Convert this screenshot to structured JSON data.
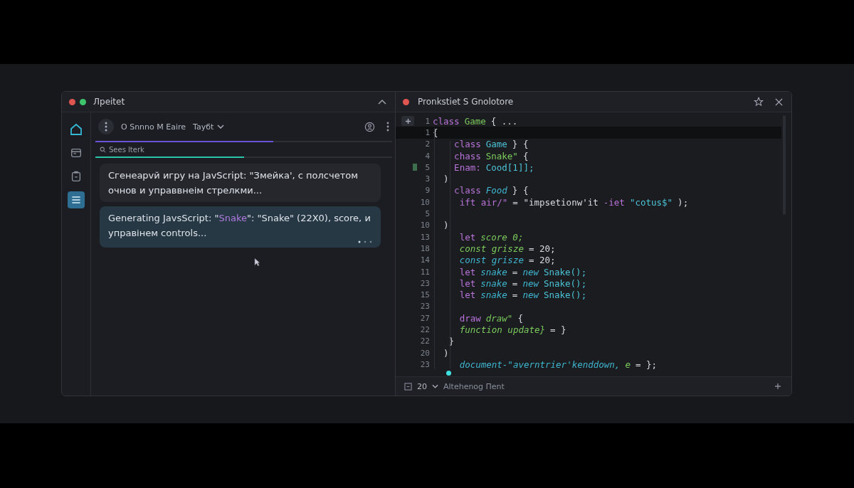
{
  "chat_window": {
    "title": "Лpeitet",
    "sidebar": [
      {
        "selected": true
      },
      {
        "selected": false
      },
      {
        "selected": false
      },
      {
        "selected": true
      }
    ],
    "header": {
      "session": "O Snnno M Eaire",
      "model": "Tayбt"
    },
    "progress": {
      "level": 0.6
    },
    "search": {
      "placeholder": "Sees lterk",
      "level": 0.5
    },
    "messages": [
      {
        "kind": "prompt",
        "segments": [
          {
            "text": "Сгенеарvй игру на JavScript: \"Змейка', с полсчетом очнов и управвнеім стрелкми...",
            "highlight": false
          }
        ],
        "typing": false
      },
      {
        "kind": "reply",
        "segments": [
          {
            "text": "Generating JavsScript: \"",
            "highlight": false
          },
          {
            "text": "Snake",
            "highlight": true
          },
          {
            "text": "\": \"Snake\" (22X0), score, и управінем controls...",
            "highlight": false
          }
        ],
        "typing": true
      }
    ]
  },
  "editor_window": {
    "title": "Pronkstiet S Gnolotore",
    "lines": [
      {
        "number": "1",
        "modified": false,
        "current": false,
        "tokens": [
          {
            "kind": "keyword",
            "text": "class"
          },
          {
            "kind": "name",
            "text": "Game"
          },
          {
            "kind": "plain",
            "text": "{ ..."
          }
        ]
      },
      {
        "number": "1",
        "modified": false,
        "current": true,
        "tokens": [
          {
            "kind": "plain",
            "text": "{"
          }
        ]
      },
      {
        "number": "2",
        "modified": false,
        "current": false,
        "tokens": [
          {
            "kind": "keyword",
            "text": "    class"
          },
          {
            "kind": "type",
            "text": "Game"
          },
          {
            "kind": "plain",
            "text": "} {"
          }
        ]
      },
      {
        "number": "4",
        "modified": false,
        "current": false,
        "tokens": [
          {
            "kind": "keyword",
            "text": "    chass"
          },
          {
            "kind": "name",
            "text": "Snake\""
          },
          {
            "kind": "plain",
            "text": "{"
          }
        ]
      },
      {
        "number": "5",
        "modified": true,
        "current": false,
        "tokens": [
          {
            "kind": "keyword",
            "text": "    Enam:"
          },
          {
            "kind": "type",
            "text": "Cood[1]];"
          }
        ]
      },
      {
        "number": "3",
        "modified": false,
        "current": false,
        "tokens": [
          {
            "kind": "plain",
            "text": "  )"
          }
        ]
      },
      {
        "number": "9",
        "modified": false,
        "current": false,
        "tokens": [
          {
            "kind": "keyword",
            "text": "    class"
          },
          {
            "kind": "ref",
            "text": "Food"
          },
          {
            "kind": "plain",
            "text": "} {"
          }
        ]
      },
      {
        "number": "10",
        "modified": false,
        "current": false,
        "tokens": [
          {
            "kind": "keyword",
            "text": "     ift air/\""
          },
          {
            "kind": "plain",
            "text": "= \"impsetionw'it"
          },
          {
            "kind": "keyword",
            "text": "-iet"
          },
          {
            "kind": "type",
            "text": "\"cotus$\""
          },
          {
            "kind": "plain",
            "text": ");"
          }
        ]
      },
      {
        "number": "5",
        "modified": false,
        "current": false
      },
      {
        "number": "10",
        "modified": false,
        "current": false,
        "tokens": [
          {
            "kind": "plain",
            "text": "  )"
          }
        ]
      },
      {
        "number": "13",
        "modified": false,
        "current": false,
        "tokens": [
          {
            "kind": "keyword",
            "text": "     let"
          },
          {
            "kind": "value",
            "text": "score 0;"
          }
        ]
      },
      {
        "number": "18",
        "modified": false,
        "current": false,
        "tokens": [
          {
            "kind": "value",
            "text": "     const grisze"
          },
          {
            "kind": "plain",
            "text": "= 20;"
          }
        ]
      },
      {
        "number": "14",
        "modified": false,
        "current": false,
        "tokens": [
          {
            "kind": "ref",
            "text": "     const grisze"
          },
          {
            "kind": "plain",
            "text": "= 20;"
          }
        ]
      },
      {
        "number": "11",
        "modified": false,
        "current": false,
        "tokens": [
          {
            "kind": "keyword",
            "text": "     let"
          },
          {
            "kind": "ref",
            "text": "snake"
          },
          {
            "kind": "plain",
            "text": "="
          },
          {
            "kind": "ref",
            "text": "new"
          },
          {
            "kind": "type",
            "text": "Snake();"
          }
        ]
      },
      {
        "number": "23",
        "modified": false,
        "current": false,
        "tokens": [
          {
            "kind": "keyword",
            "text": "     let"
          },
          {
            "kind": "ref",
            "text": "snake"
          },
          {
            "kind": "plain",
            "text": "="
          },
          {
            "kind": "ref",
            "text": "new"
          },
          {
            "kind": "type",
            "text": "Snake();"
          }
        ]
      },
      {
        "number": "15",
        "modified": false,
        "current": false,
        "tokens": [
          {
            "kind": "keyword",
            "text": "     let"
          },
          {
            "kind": "ref",
            "text": "snake"
          },
          {
            "kind": "plain",
            "text": "="
          },
          {
            "kind": "ref",
            "text": "new"
          },
          {
            "kind": "type",
            "text": "Snake();"
          }
        ]
      },
      {
        "number": "23",
        "modified": false,
        "current": false
      },
      {
        "number": "27",
        "modified": false,
        "current": false,
        "tokens": [
          {
            "kind": "keyword",
            "text": "     draw"
          },
          {
            "kind": "value",
            "text": "draw\""
          },
          {
            "kind": "plain",
            "text": "{"
          }
        ]
      },
      {
        "number": "22",
        "modified": false,
        "current": false,
        "tokens": [
          {
            "kind": "value",
            "text": "     function update}"
          },
          {
            "kind": "plain",
            "text": "= }"
          }
        ]
      },
      {
        "number": "22",
        "modified": false,
        "current": false,
        "tokens": [
          {
            "kind": "plain",
            "text": "   }"
          }
        ]
      },
      {
        "number": "20",
        "modified": false,
        "current": false,
        "tokens": [
          {
            "kind": "plain",
            "text": "  )"
          }
        ]
      },
      {
        "number": "23",
        "modified": false,
        "current": false,
        "tokens": [
          {
            "kind": "ref",
            "text": "     document-\"averntrier'kenddown,"
          },
          {
            "kind": "value",
            "text": "e"
          },
          {
            "kind": "plain",
            "text": "= };"
          }
        ]
      }
    ],
    "status_bar": {
      "count": "20",
      "label": "Altehenog Пent"
    }
  }
}
